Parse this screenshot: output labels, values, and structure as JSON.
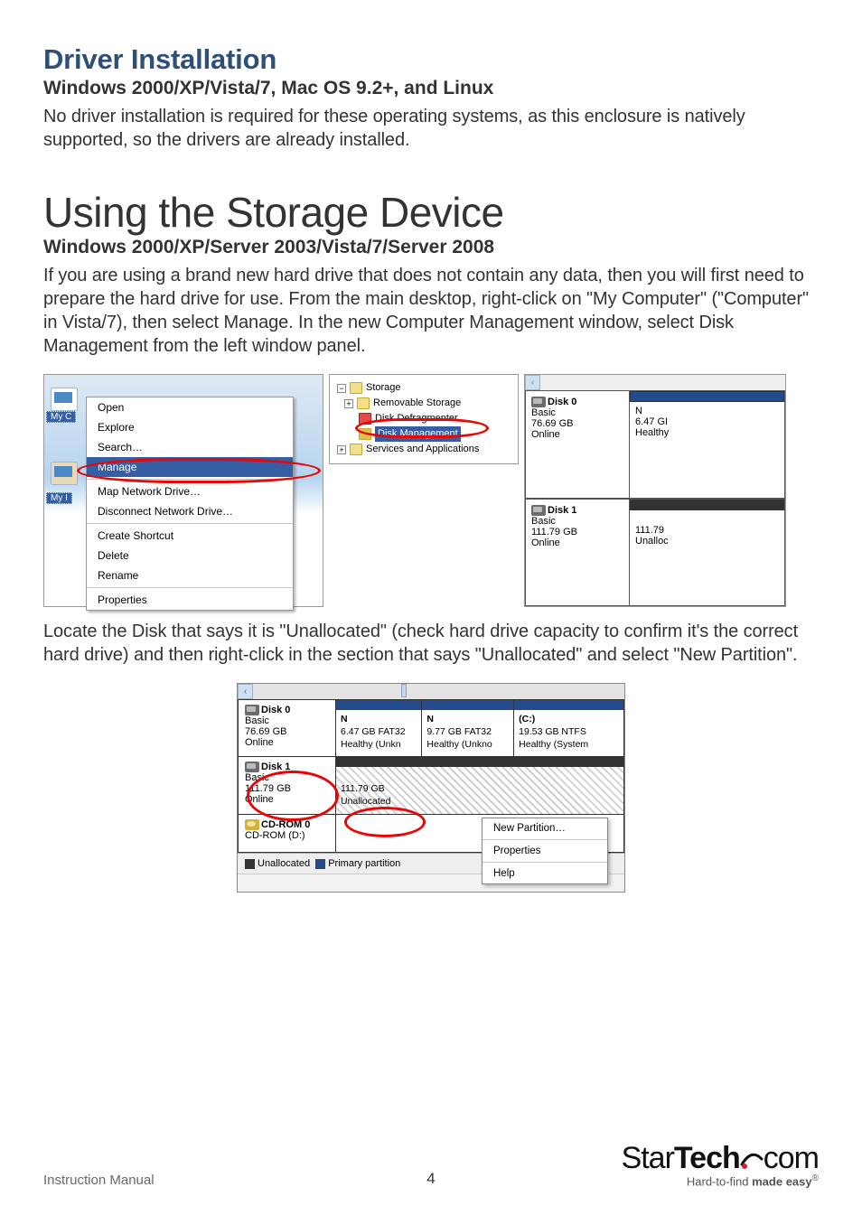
{
  "headings": {
    "driver_install": "Driver Installation",
    "sub_a": "Windows 2000/XP/Vista/7, Mac OS 9.2+, and Linux",
    "big": "Using the Storage Device",
    "sub_b": "Windows 2000/XP/Server 2003/Vista/7/Server 2008"
  },
  "paragraphs": {
    "p1": "No driver installation is required for these operating systems, as this enclosure is natively supported, so the drivers are already installed.",
    "p2": "If you are using a brand new hard drive that does not contain any data, then you will first need to prepare the hard drive for use.  From the main desktop, right-click on \"My Computer\" (\"Computer\" in Vista/7), then select Manage. In the new Computer Management window, select Disk Management from the left window panel.",
    "p3": "Locate the Disk that says it is \"Unallocated\" (check hard drive capacity to confirm it's the correct hard drive) and then right-click in the section that says \"Unallocated\" and select \"New Partition\"."
  },
  "fig1": {
    "icon_labels": {
      "myc": "My C",
      "myn": "My I"
    },
    "menu": {
      "open": "Open",
      "explore": "Explore",
      "search": "Search…",
      "manage": "Manage",
      "map": "Map Network Drive…",
      "disconnect": "Disconnect Network Drive…",
      "shortcut": "Create Shortcut",
      "delete": "Delete",
      "rename": "Rename",
      "properties": "Properties"
    }
  },
  "fig2": {
    "storage": "Storage",
    "removable": "Removable Storage",
    "defrag": "Disk Defragmenter",
    "diskmgmt": "Disk Management",
    "services": "Services and Applications"
  },
  "fig3": {
    "disk0": {
      "name": "Disk 0",
      "type": "Basic",
      "size": "76.69 GB",
      "status": "Online"
    },
    "disk0r": {
      "l1": "N",
      "l2": "6.47 GI",
      "l3": "Healthy"
    },
    "disk1": {
      "name": "Disk 1",
      "type": "Basic",
      "size": "111.79 GB",
      "status": "Online"
    },
    "disk1r": {
      "l2": "111.79",
      "l3": "Unalloc"
    }
  },
  "fig4": {
    "disk0": {
      "name": "Disk 0",
      "type": "Basic",
      "size": "76.69 GB",
      "status": "Online"
    },
    "disk0parts": [
      {
        "l1": "N",
        "l2": "6.47 GB FAT32",
        "l3": "Healthy (Unkn"
      },
      {
        "l1": "N",
        "l2": "9.77 GB FAT32",
        "l3": "Healthy (Unkno"
      },
      {
        "l1": "(C:)",
        "l2": "19.53 GB NTFS",
        "l3": "Healthy (System"
      }
    ],
    "disk1": {
      "name": "Disk 1",
      "type": "Basic",
      "size": "111.79 GB",
      "status": "Online"
    },
    "disk1part": {
      "l2": "111.79 GB",
      "l3": "Unallocated"
    },
    "cdrom": {
      "name": "CD-ROM 0",
      "sub": "CD-ROM (D:)"
    },
    "legend": {
      "unalloc": "Unallocated",
      "primary": "Primary partition"
    },
    "ctx": {
      "newpart": "New Partition…",
      "props": "Properties",
      "help": "Help"
    }
  },
  "footer": {
    "manual": "Instruction Manual",
    "page": "4",
    "brand_a": "Star",
    "brand_b": "Tech",
    "brand_dot": "●",
    "brand_c": "com",
    "tag_a": "Hard-to-find ",
    "tag_b": "made easy",
    "reg": "®"
  }
}
